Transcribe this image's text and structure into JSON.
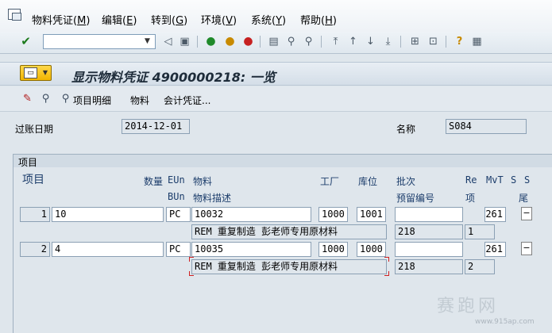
{
  "menu": {
    "items": [
      {
        "text": "物料凭证",
        "key": "M"
      },
      {
        "text": "编辑",
        "key": "E"
      },
      {
        "text": "转到",
        "key": "G"
      },
      {
        "text": "环境",
        "key": "V"
      },
      {
        "text": "系统",
        "key": "Y"
      },
      {
        "text": "帮助",
        "key": "H"
      }
    ]
  },
  "command_field": {
    "value": ""
  },
  "title": "显示物料凭证 4900000218: 一览",
  "app_toolbar": {
    "item_details": "项目明细",
    "material": "物料",
    "accounting_doc": "会计凭证..."
  },
  "header": {
    "posting_date_label": "过账日期",
    "posting_date": "2014-12-01",
    "name_label": "名称",
    "name": "S084"
  },
  "items_group": {
    "title": "项目",
    "columns": {
      "item": "项目",
      "qty": "数量",
      "eun": "EUn",
      "material": "物料",
      "plant": "工厂",
      "sloc": "库位",
      "batch": "批次",
      "re": "Re",
      "mvt": "MvT",
      "s1": "S",
      "s2": "S",
      "bun": "BUn",
      "mat_desc": "物料描述",
      "reservation": "预留编号",
      "item2": "项",
      "tail": "尾"
    },
    "rows": [
      {
        "line": "1",
        "qty": "10",
        "eun": "PC",
        "material": "10032",
        "plant": "1000",
        "sloc": "1001",
        "batch": "",
        "mvt": "261",
        "flag": "−",
        "description": "REM 重复制造 彭老师专用原材料",
        "reservation": "218",
        "res_item": "1"
      },
      {
        "line": "2",
        "qty": "4",
        "eun": "PC",
        "material": "10035",
        "plant": "1000",
        "sloc": "1000",
        "batch": "",
        "mvt": "261",
        "flag": "−",
        "description": "REM 重复制造 彭老师专用原材料",
        "reservation": "218",
        "res_item": "2"
      }
    ]
  },
  "watermark": {
    "text": "赛跑网",
    "url": "www.915ap.com"
  }
}
